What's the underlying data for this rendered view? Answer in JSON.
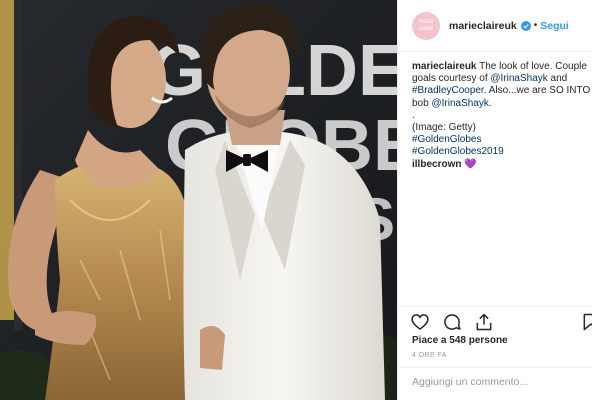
{
  "post": {
    "image_alt": "Couple on red carpet at the Golden Globes",
    "backdrop_text": [
      "GOLDEN",
      "GLOBE",
      "S"
    ]
  },
  "header": {
    "avatar_text": "marie claire",
    "username": "marieclaireuk",
    "separator": "•",
    "follow_label": "Segui"
  },
  "caption": {
    "username": "marieclaireuk",
    "text_1": " The look of love. Couple",
    "text_2": "goals courtesy of ",
    "mention_1": "@IrinaShayk",
    "text_3": " and",
    "hashtag_1": "#BradleyCooper",
    "text_4": ". Also...we are SO INTO th",
    "text_5": "bob ",
    "mention_2": "@IrinaShayk",
    "text_6": ".",
    "dot_line": ".",
    "credit": "(Image: Getty)",
    "hashtag_2": "#GoldenGlobes",
    "hashtag_3": "#GoldenGlobes2019"
  },
  "comment": {
    "username": "illbecrown",
    "emoji": "💜"
  },
  "engagement": {
    "likes": "Piace a 548 persone",
    "timestamp": "4 ORE FA",
    "add_comment_placeholder": "Aggiungi un commento..."
  },
  "colors": {
    "link_blue": "#3897f0",
    "mention_blue": "#003569",
    "muted": "#999999",
    "avatar_pink": "#f6c2cc"
  }
}
